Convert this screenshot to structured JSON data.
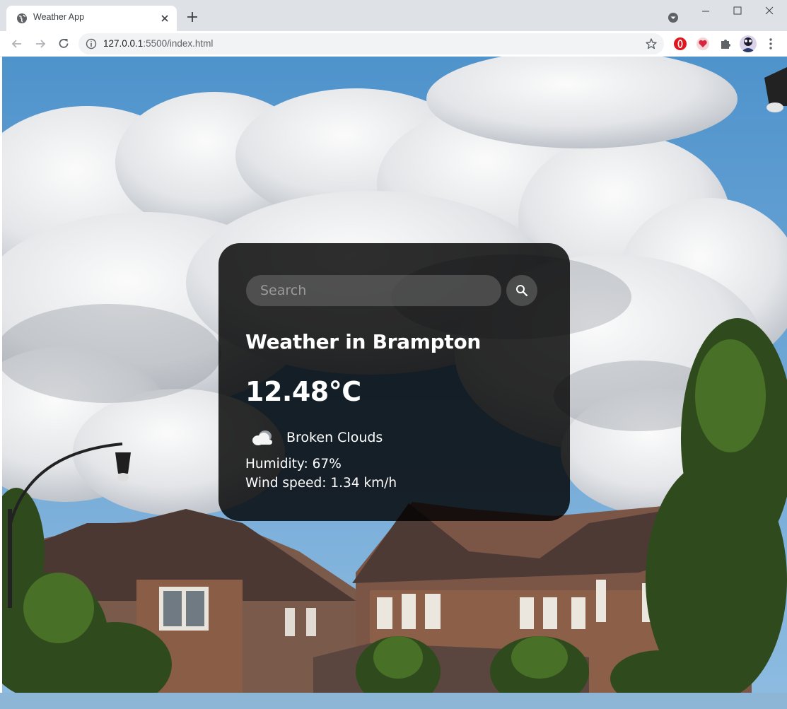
{
  "browser": {
    "tab_title": "Weather App",
    "url_host": "127.0.0.1",
    "url_rest": ":5500/index.html"
  },
  "weather": {
    "search_placeholder": "Search",
    "city_line": "Weather in Brampton",
    "temperature": "12.48°C",
    "condition": "Broken Clouds",
    "humidity": "Humidity: 67%",
    "wind": "Wind speed: 1.34 km/h",
    "condition_icon": "cloud-icon"
  },
  "colors": {
    "card_bg": "#000000d1",
    "sky": "#5b9bd0",
    "cloud": "#eef0f2"
  }
}
